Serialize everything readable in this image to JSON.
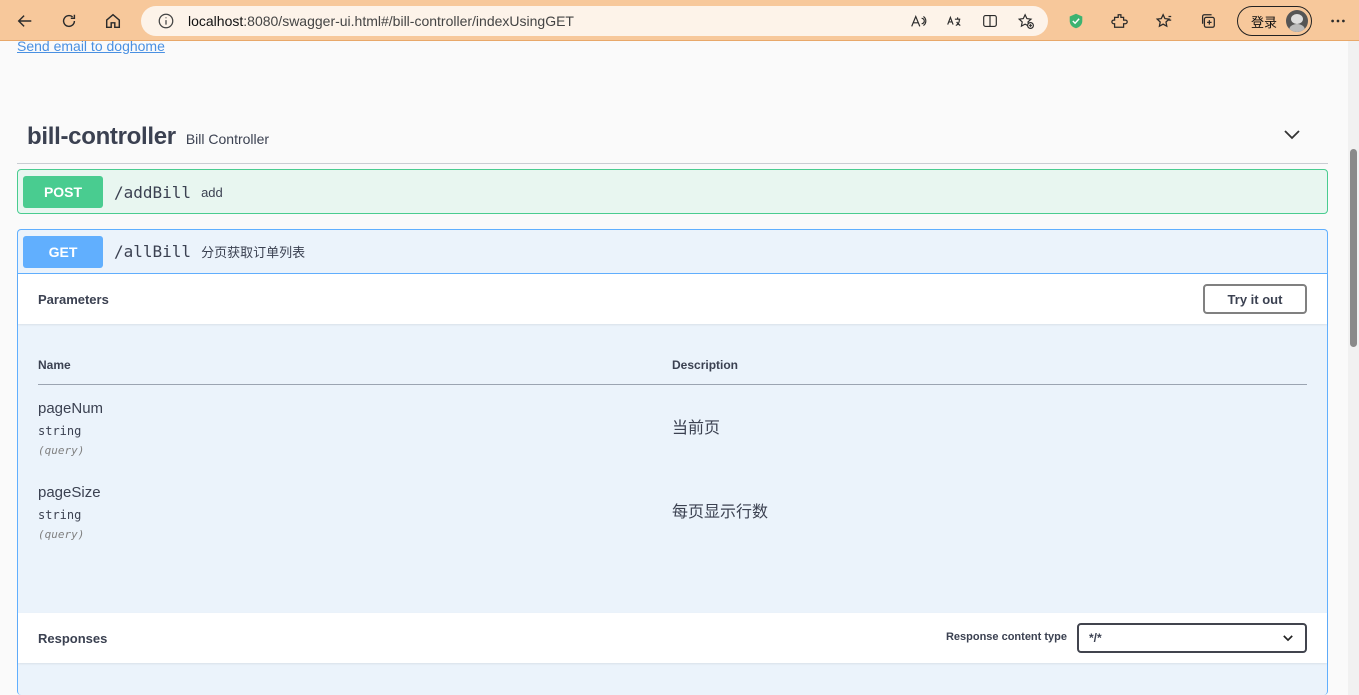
{
  "browser": {
    "url_host": "localhost",
    "url_rest": ":8080/swagger-ui.html#/bill-controller/indexUsingGET",
    "login_label": "登录"
  },
  "info": {
    "contact_link": "Send email to doghome"
  },
  "tag": {
    "name": "bill-controller",
    "description": "Bill Controller"
  },
  "operations": [
    {
      "method": "POST",
      "path": "/addBill",
      "summary": "add"
    },
    {
      "method": "GET",
      "path": "/allBill",
      "summary": "分页获取订单列表"
    }
  ],
  "parameters_section": {
    "title": "Parameters",
    "try_label": "Try it out",
    "col_name": "Name",
    "col_description": "Description",
    "rows": [
      {
        "name": "pageNum",
        "type": "string",
        "in": "(query)",
        "description": "当前页"
      },
      {
        "name": "pageSize",
        "type": "string",
        "in": "(query)",
        "description": "每页显示行数"
      }
    ]
  },
  "responses_section": {
    "title": "Responses",
    "content_type_label": "Response content type",
    "content_type_value": "*/*"
  },
  "colors": {
    "post": "#49cc90",
    "get": "#61affe",
    "browser_bar": "#f7c89b"
  }
}
